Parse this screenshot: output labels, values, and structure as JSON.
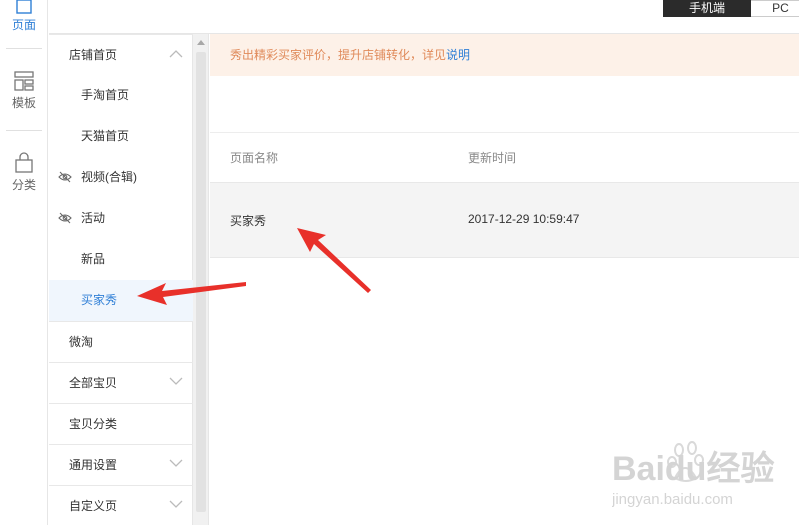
{
  "rail": {
    "page_label": "页面",
    "template_label": "模板",
    "category_label": "分类"
  },
  "topbar": {
    "mobile_label": "手机端",
    "pc_label": "PC"
  },
  "nav": {
    "items": [
      {
        "label": "店铺首页",
        "kind": "group",
        "chevron": "up"
      },
      {
        "label": "手淘首页",
        "kind": "sub"
      },
      {
        "label": "天猫首页",
        "kind": "sub"
      },
      {
        "label": "视频(合辑)",
        "kind": "hidden"
      },
      {
        "label": "活动",
        "kind": "hidden"
      },
      {
        "label": "新品",
        "kind": "sub"
      },
      {
        "label": "买家秀",
        "kind": "sub",
        "active": true
      },
      {
        "label": "微淘",
        "kind": "group"
      },
      {
        "label": "全部宝贝",
        "kind": "group",
        "chevron": "down"
      },
      {
        "label": "宝贝分类",
        "kind": "group"
      },
      {
        "label": "通用设置",
        "kind": "group",
        "chevron": "down"
      },
      {
        "label": "自定义页",
        "kind": "group",
        "chevron": "down"
      }
    ]
  },
  "notice": {
    "text": "秀出精彩买家评价，提升店铺转化，详见",
    "link": "说明"
  },
  "table": {
    "headers": [
      "页面名称",
      "更新时间"
    ],
    "rows": [
      {
        "name": "买家秀",
        "updated": "2017-12-29 10:59:47"
      }
    ]
  },
  "watermark": {
    "brand": "Baidu经验",
    "url": "jingyan.baidu.com"
  },
  "colors": {
    "accent": "#2f7fd6",
    "notice_bg": "#fdf1e8",
    "arrow": "#e8302a"
  }
}
